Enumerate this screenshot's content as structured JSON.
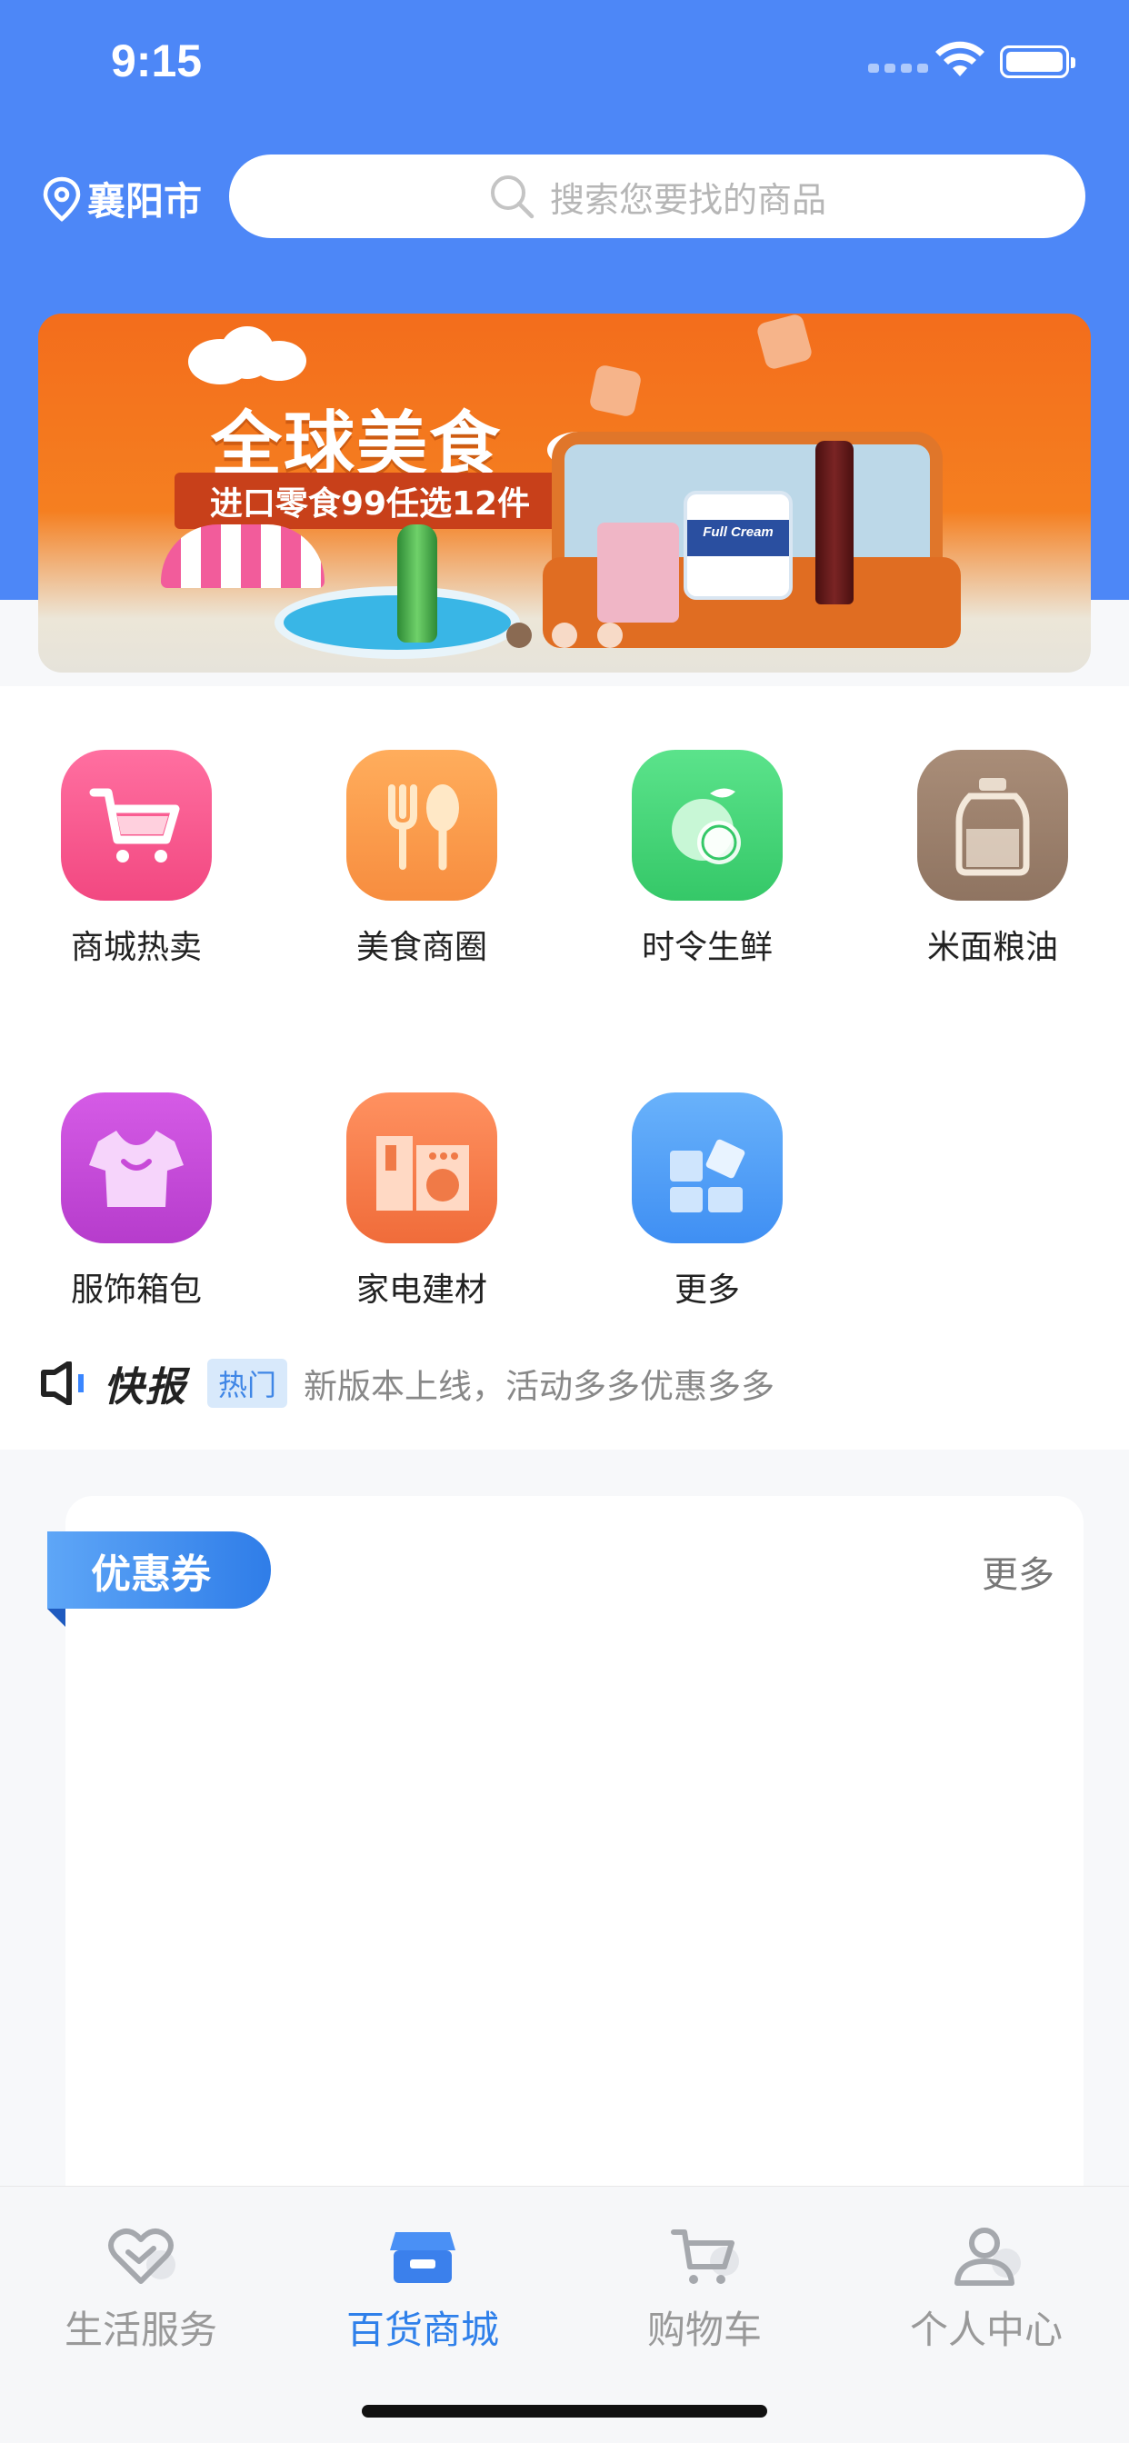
{
  "status_bar": {
    "time": "9:15"
  },
  "header": {
    "location": "襄阳市",
    "search_placeholder": "搜索您要找的商品",
    "icons": {
      "location": "location-pin-icon",
      "search": "search-icon"
    }
  },
  "banner": {
    "title": "全球美食",
    "subtitle": "进口零食99任选12件",
    "product_label": "Full Cream",
    "slide_count": 3,
    "active_slide": 1
  },
  "categories": [
    {
      "label": "商城热卖",
      "icon": "shopping-cart-icon",
      "color": "#f4578d"
    },
    {
      "label": "美食商圈",
      "icon": "fork-spoon-icon",
      "color": "#f89a47"
    },
    {
      "label": "时令生鲜",
      "icon": "orange-fruit-icon",
      "color": "#46d67a"
    },
    {
      "label": "米面粮油",
      "icon": "oil-bottle-icon",
      "color": "#9b7f6a"
    },
    {
      "label": "服饰箱包",
      "icon": "tshirt-icon",
      "color": "#c94ed9"
    },
    {
      "label": "家电建材",
      "icon": "washing-machine-icon",
      "color": "#f57d4b"
    },
    {
      "label": "更多",
      "icon": "more-grid-icon",
      "color": "#4f9ef8"
    }
  ],
  "news": {
    "title": "快报",
    "tag": "热门",
    "text": "新版本上线，活动多多优惠多多"
  },
  "coupon": {
    "title": "优惠券",
    "more": "更多"
  },
  "tabbar": {
    "items": [
      {
        "label": "生活服务",
        "icon": "heart-icon",
        "active": false
      },
      {
        "label": "百货商城",
        "icon": "store-icon",
        "active": true
      },
      {
        "label": "购物车",
        "icon": "cart-icon",
        "active": false
      },
      {
        "label": "个人中心",
        "icon": "user-icon",
        "active": false
      }
    ]
  }
}
